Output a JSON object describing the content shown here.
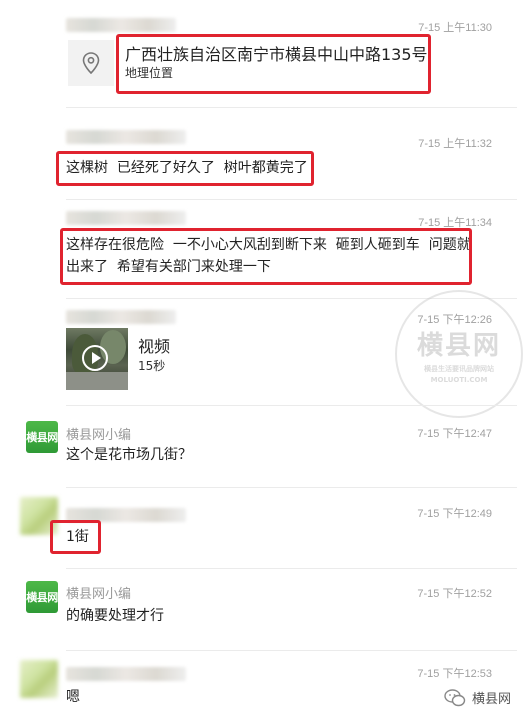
{
  "messages": [
    {
      "time": "7-15 上午11:30",
      "type": "location",
      "title": "广西壮族自治区南宁市横县中山中路135号",
      "subtitle": "地理位置"
    },
    {
      "time": "7-15 上午11:32",
      "type": "text",
      "text": "这棵树  已经死了好久了  树叶都黄完了"
    },
    {
      "time": "7-15 上午11:34",
      "type": "text",
      "text_line1": "这样存在很危险  一不小心大风刮到断下来  砸到人砸到车  问题就",
      "text_line2": "出来了  希望有关部门来处理一下"
    },
    {
      "time": "7-15 下午12:26",
      "type": "video",
      "label": "视频",
      "duration": "15秒"
    },
    {
      "time": "7-15 下午12:47",
      "type": "text",
      "sender": "横县网小编",
      "text": "这个是花市场几街？",
      "avatar_text": "横县网"
    },
    {
      "time": "7-15 下午12:49",
      "type": "text",
      "text": "1街"
    },
    {
      "time": "7-15 下午12:52",
      "type": "text",
      "sender": "横县网小编",
      "text": "的确要处理才行",
      "avatar_text": "横县网"
    },
    {
      "time": "7-15 下午12:53",
      "type": "text",
      "text": "嗯"
    }
  ],
  "watermark": {
    "title": "横县网",
    "tagline": "横县生活要讯品牌网站",
    "url": "MOLUOTI.COM"
  },
  "footer": {
    "brand": "横县网"
  },
  "colors": {
    "highlight": "#e0232f",
    "brand_green": "#3aa83f"
  }
}
